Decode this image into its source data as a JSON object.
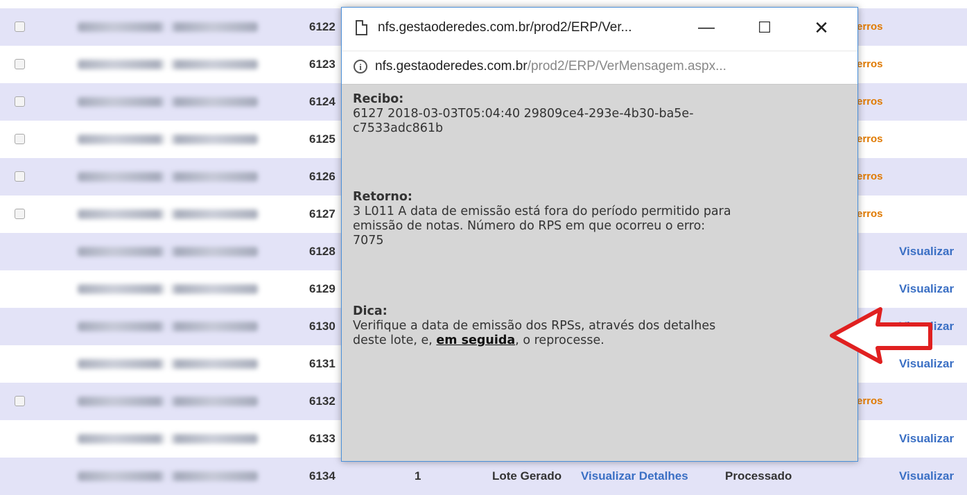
{
  "background_table": {
    "rows": [
      {
        "num": "6122",
        "checkbox": true,
        "status": "erros"
      },
      {
        "num": "6123",
        "checkbox": true,
        "status": "erros"
      },
      {
        "num": "6124",
        "checkbox": true,
        "status": "erros"
      },
      {
        "num": "6125",
        "checkbox": true,
        "status": "erros"
      },
      {
        "num": "6126",
        "checkbox": true,
        "status": "erros"
      },
      {
        "num": "6127",
        "checkbox": true,
        "status": "erros"
      },
      {
        "num": "6128",
        "checkbox": false,
        "status": "Visualizar"
      },
      {
        "num": "6129",
        "checkbox": false,
        "status": "Visualizar"
      },
      {
        "num": "6130",
        "checkbox": false,
        "status": "Visualizar"
      },
      {
        "num": "6131",
        "checkbox": false,
        "status": "Visualizar"
      },
      {
        "num": "6132",
        "checkbox": true,
        "status": "erros"
      },
      {
        "num": "6133",
        "checkbox": false,
        "status": "Visualizar"
      },
      {
        "num": "6134",
        "checkbox": false,
        "status": "Visualizar"
      }
    ],
    "last_row_extra": {
      "count": "1",
      "state": "Lote Gerado",
      "details_link": "Visualizar Detalhes",
      "result": "Processado"
    }
  },
  "popup": {
    "title": "nfs.gestaoderedes.com.br/prod2/ERP/Ver...",
    "url_host": "nfs.gestaoderedes.com.br",
    "url_path": "/prod2/ERP/VerMensagem.aspx...",
    "recibo": {
      "heading": "Recibo:",
      "line1": "6127 2018-03-03T05:04:40 29809ce4-293e-4b30-ba5e-",
      "line2": "c7533adc861b"
    },
    "retorno": {
      "heading": "Retorno:",
      "line1": "3 L011 A data de emissão está fora do período permitido para",
      "line2": "emissão de notas. Número do RPS em que ocorreu o erro:",
      "line3": "7075"
    },
    "dica": {
      "heading": "Dica:",
      "line1": "Verifique a data de emissão dos RPSs, através dos detalhes",
      "line2_pre": "deste lote, e, ",
      "line2_link": "em seguida",
      "line2_post": ", o reprocesse."
    }
  },
  "colors": {
    "row_odd": "#e3e3f7",
    "link_blue": "#3a6fc4",
    "erros_orange": "#e07a00",
    "arrow_red": "#e02020",
    "popup_border": "#4a90d9"
  }
}
